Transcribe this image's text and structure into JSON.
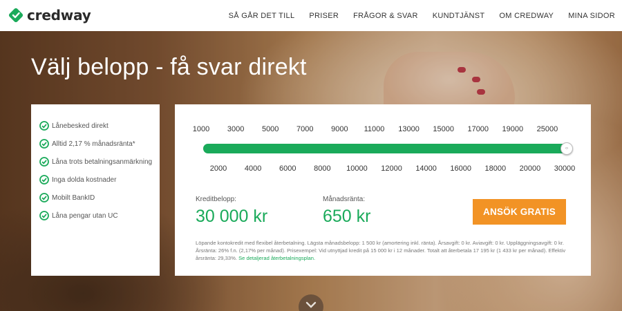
{
  "brand": {
    "name": "credway",
    "color": "#1aaa5a",
    "logo_icon": "credway-diamond-logo"
  },
  "nav": {
    "items": [
      {
        "label": "SÅ GÅR DET TILL"
      },
      {
        "label": "PRISER"
      },
      {
        "label": "FRÅGOR & SVAR"
      },
      {
        "label": "KUNDTJÄNST"
      },
      {
        "label": "OM CREDWAY"
      },
      {
        "label": "MINA SIDOR"
      }
    ]
  },
  "hero": {
    "headline": "Välj belopp - få svar direkt"
  },
  "features": {
    "icon": "check-circle-icon",
    "items": [
      {
        "label": "Lånebesked direkt"
      },
      {
        "label": "Alltid 2,17 % månadsränta*"
      },
      {
        "label": "Låna trots betalningsanmärkning"
      },
      {
        "label": "Inga dolda kostnader"
      },
      {
        "label": "Mobilt BankID"
      },
      {
        "label": "Låna pengar utan UC"
      }
    ]
  },
  "slider": {
    "min": 1000,
    "max": 30000,
    "value": 30000,
    "fill_color": "#1aaa5a",
    "ticks_top": [
      "1000",
      "3000",
      "5000",
      "7000",
      "9000",
      "11000",
      "13000",
      "15000",
      "17000",
      "19000",
      "25000"
    ],
    "ticks_bottom": [
      "2000",
      "4000",
      "6000",
      "8000",
      "10000",
      "12000",
      "14000",
      "16000",
      "18000",
      "20000",
      "30000"
    ]
  },
  "summary": {
    "credit_label": "Kreditbelopp:",
    "credit_value": "30 000 kr",
    "rate_label": "Månadsränta:",
    "rate_value": "650 kr",
    "apply_label": "ANSÖK GRATIS",
    "apply_color": "#f29325"
  },
  "fine_print": {
    "text": "Löpande kontokredit med flexibel återbetalning. Lägsta månadsbelopp: 1 500 kr (amortering inkl. ränta). Årsavgift: 0 kr. Aviavgift: 0 kr. Uppläggningsavgift: 0 kr. Årsränta: 26% f.n. (2,17% per månad). Prisexempel: Vid utnyttjad kredit på 15 000 kr i 12 månader. Totalt att återbetala 17 195 kr (1 433 kr per månad). Effektiv årsränta: 29,33%.",
    "link": "Se detaljerad återbetalningsplan."
  },
  "scroll": {
    "icon": "chevron-down-icon"
  }
}
